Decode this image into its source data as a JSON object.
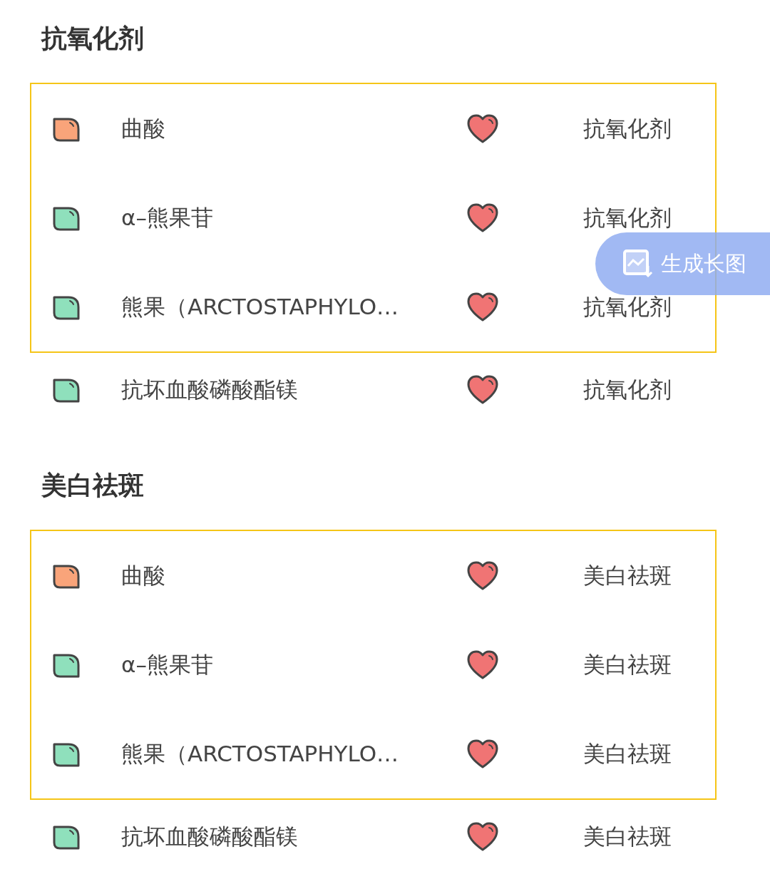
{
  "sections": [
    {
      "title": "抗氧化剂",
      "items": [
        {
          "name": "曲酸",
          "category": "抗氧化剂",
          "color": "#f9a47a",
          "highlighted": true
        },
        {
          "name": "α–熊果苷",
          "category": "抗氧化剂",
          "color": "#8fe0bc",
          "highlighted": true
        },
        {
          "name": "熊果（ARCTOSTAPHYLO…",
          "category": "抗氧化剂",
          "color": "#8fe0bc",
          "highlighted": true
        },
        {
          "name": "抗坏血酸磷酸酯镁",
          "category": "抗氧化剂",
          "color": "#8fe0bc",
          "highlighted": false
        }
      ]
    },
    {
      "title": "美白祛斑",
      "items": [
        {
          "name": "曲酸",
          "category": "美白祛斑",
          "color": "#f9a47a",
          "highlighted": true
        },
        {
          "name": "α–熊果苷",
          "category": "美白祛斑",
          "color": "#8fe0bc",
          "highlighted": true
        },
        {
          "name": "熊果（ARCTOSTAPHYLO…",
          "category": "美白祛斑",
          "color": "#8fe0bc",
          "highlighted": true
        },
        {
          "name": "抗坏血酸磷酸酯镁",
          "category": "美白祛斑",
          "color": "#8fe0bc",
          "highlighted": false
        }
      ]
    }
  ],
  "float_button": {
    "label": "生成长图"
  }
}
